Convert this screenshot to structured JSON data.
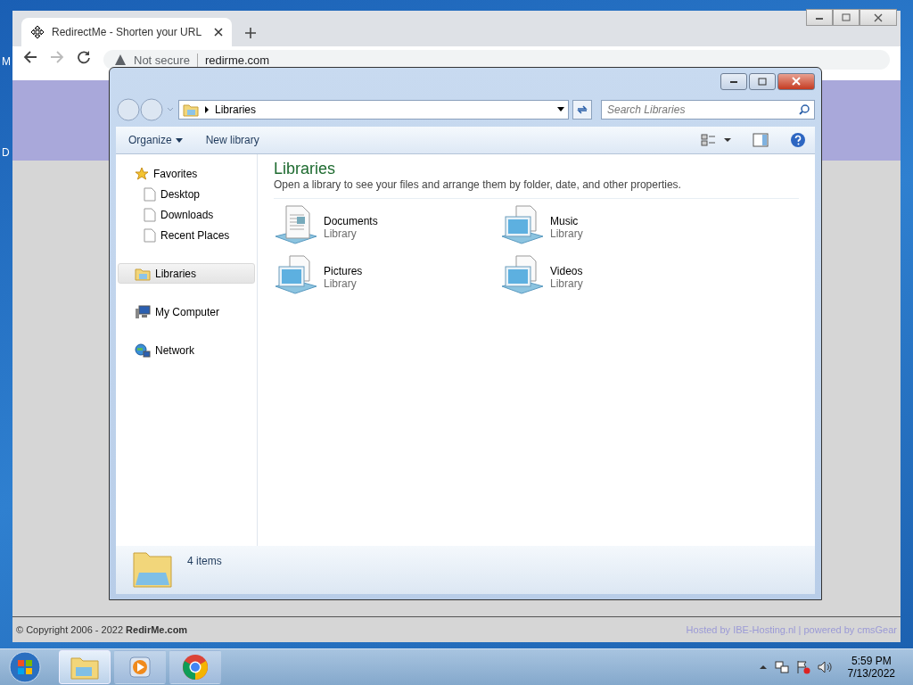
{
  "desktop_labels": [
    "M",
    "D"
  ],
  "browser": {
    "tab_title": "RedirectMe - Shorten your URL",
    "security": "Not secure",
    "url": "redirme.com"
  },
  "explorer": {
    "address": "Libraries",
    "search": {
      "placeholder": "Search Libraries"
    },
    "commands": [
      "Organize",
      "New library"
    ],
    "nav": [
      {
        "label": "Favorites",
        "kind": "star",
        "selected": false,
        "children": [
          {
            "label": "Desktop",
            "kind": "page",
            "selected": false
          },
          {
            "label": "Downloads",
            "kind": "page",
            "selected": false
          },
          {
            "label": "Recent Places",
            "kind": "page",
            "selected": false
          }
        ]
      },
      {
        "label": "Libraries",
        "kind": "library",
        "selected": true
      },
      {
        "label": "My Computer",
        "kind": "computer",
        "selected": false
      },
      {
        "label": "Network",
        "kind": "network",
        "selected": false
      }
    ],
    "heading": "Libraries",
    "description": "Open a library to see your files and arrange them by folder, date, and other properties.",
    "libraries": [
      {
        "name": "Documents",
        "type": "Library",
        "kind": "document"
      },
      {
        "name": "Music",
        "type": "Library",
        "kind": "screen"
      },
      {
        "name": "Pictures",
        "type": "Library",
        "kind": "screen"
      },
      {
        "name": "Videos",
        "type": "Library",
        "kind": "screen"
      }
    ],
    "status": "4 items"
  },
  "footer": {
    "copyright": "© Copyright 2006 - 2022 **RedirMe.com**",
    "hosted": "Hosted by IBE-Hosting.nl | powered by cmsGear"
  },
  "taskbar": {
    "apps": [
      {
        "kind": "explorer",
        "selected": true
      },
      {
        "kind": "media",
        "selected": false
      },
      {
        "kind": "chrome",
        "selected": false
      }
    ],
    "time": "5:59 PM",
    "date": "7/13/2022"
  }
}
